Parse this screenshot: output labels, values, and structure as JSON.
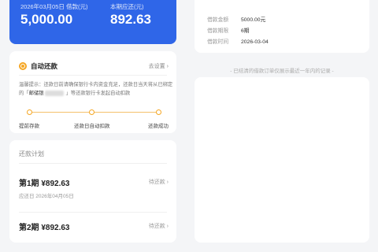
{
  "summary": {
    "loan_date_label": "2026年03月05日 借款(元)",
    "loan_amount": "5,000.00",
    "due_label": "本期应还(元)",
    "due_amount": "892.63"
  },
  "autopay": {
    "title": "自动还款",
    "link": "去设置",
    "notice_pre": "温馨提示：还款日前请确保银行卡内资金充足，还款日当天将从已绑定的「",
    "bank": "邮储银",
    "notice_post": "」等还款银行卡发起自动扣款",
    "steps": [
      "提前存款",
      "还款日自动扣款",
      "还款成功"
    ]
  },
  "plan": {
    "title": "还款计划",
    "periods": [
      {
        "title": "第1期 ¥892.63",
        "date": "应还日 2026年04月05日",
        "status": "待还款"
      },
      {
        "title": "第2期 ¥892.63",
        "status": "待还款"
      }
    ]
  },
  "details": {
    "rows": [
      {
        "key": "借款金额",
        "value": "5000.00元"
      },
      {
        "key": "借款期限",
        "value": "6期"
      },
      {
        "key": "借款时间",
        "value": "2026-03-04"
      }
    ],
    "footnote": "- 已结清的借款订单仅展示最近一年内的记录 -"
  },
  "colors": {
    "accent": "#2f66e8",
    "orange": "#f5a623",
    "bg": "#f4f5f7"
  }
}
